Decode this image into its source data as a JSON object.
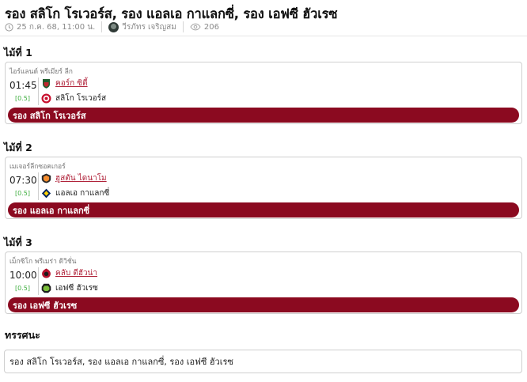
{
  "article": {
    "title": "รอง สลิโก โรเวอร์ส, รอง แอลเอ กาแลกซี่, รอง เอฟซี ฮัวเรซ",
    "date": "25 ก.ค. 68, 11:00 น.",
    "author": "วีรภัทร เจริญสม",
    "views": "206"
  },
  "icons": {
    "date": "clock-icon",
    "views": "eye-icon"
  },
  "colors": {
    "verdict_bar": "#8b0a20",
    "handicap": "#3fae3f",
    "home_team_link": "#b0233a"
  },
  "picks": [
    {
      "heading": "ไม้ที่ 1",
      "league": "ไอร์แลนด์ พรีเมียร์ ลีก",
      "time": "01:45",
      "handicap": "[0.5]",
      "home": "คอร์ก ซิตี้",
      "away": "สลิโก โรเวอร์ส",
      "verdict": "รอง สลิโก โรเวอร์ส"
    },
    {
      "heading": "ไม้ที่ 2",
      "league": "เมเจอร์ลีกซอคเกอร์",
      "time": "07:30",
      "handicap": "[0.5]",
      "home": "ฮูสตัน ไดนาโม",
      "away": "แอลเอ กาแลกซี่",
      "verdict": "รอง แอลเอ กาแลกซี่"
    },
    {
      "heading": "ไม้ที่ 3",
      "league": "เม็กซิโก พรีเมร่า ดิวิชั่น",
      "time": "10:00",
      "handicap": "[0.5]",
      "home": "คลับ ตีฮัวน่า",
      "away": "เอฟซี ฮัวเรซ",
      "verdict": "รอง เอฟซี ฮัวเรซ"
    }
  ],
  "summary": {
    "heading": "ทรรศนะ",
    "text": "รอง สลิโก โรเวอร์ส, รอง แอลเอ กาแลกซี่, รอง เอฟซี ฮัวเรซ"
  }
}
